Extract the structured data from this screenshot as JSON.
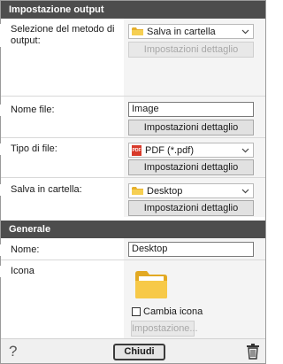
{
  "output_section": {
    "title": "Impostazione output",
    "method_label": "Selezione del metodo di output:",
    "method_value": "Salva in cartella",
    "method_details_button": "Impostazioni dettaglio",
    "filename_label": "Nome file:",
    "filename_value": "Image",
    "filename_details_button": "Impostazioni dettaglio",
    "filetype_label": "Tipo di file:",
    "filetype_value": "PDF (*.pdf)",
    "filetype_details_button": "Impostazioni dettaglio",
    "savefolder_label": "Salva in cartella:",
    "savefolder_value": "Desktop",
    "savefolder_details_button": "Impostazioni dettaglio"
  },
  "general_section": {
    "title": "Generale",
    "name_label": "Nome:",
    "name_value": "Desktop",
    "icon_label": "Icona",
    "change_icon_label": "Cambia icona",
    "change_icon_checked": false,
    "icon_settings_button": "Impostazione..."
  },
  "footer": {
    "help_symbol": "?",
    "close_button": "Chiudi"
  },
  "colors": {
    "header_bg": "#4d4d4d",
    "folder_yellow": "#f2c33a"
  },
  "icons": {
    "folder": "folder-icon",
    "pdf": "pdf-icon",
    "help": "help-icon",
    "trash": "trash-icon",
    "chevron": "chevron-down-icon"
  }
}
